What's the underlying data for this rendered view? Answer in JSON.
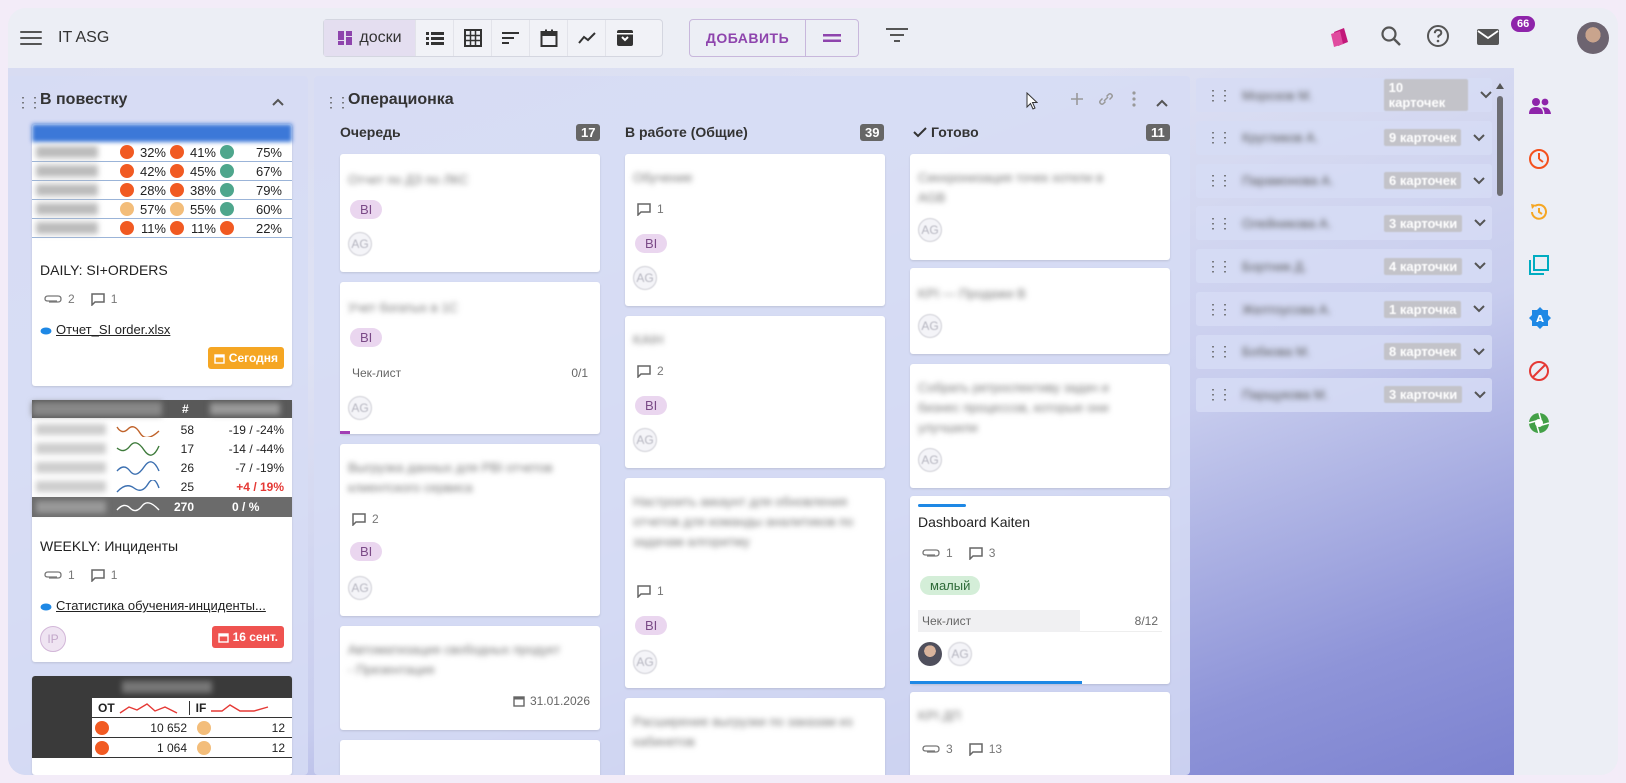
{
  "topbar": {
    "space_title": "IT ASG",
    "views": {
      "boards_label": "доски"
    },
    "add_label": "ДОБАВИТЬ",
    "notifications_count": "66"
  },
  "colors": {
    "accent": "#8e44ad",
    "badge": "#8e24aa",
    "today": "#f5a623",
    "overdue": "#ef5350"
  },
  "left_column": {
    "title": "В повестку",
    "card1": {
      "rows": [
        {
          "v1": "32%",
          "v2": "41%",
          "v3": "75%",
          "d1": "o",
          "d2": "o",
          "d3": "t"
        },
        {
          "v1": "42%",
          "v2": "45%",
          "v3": "67%",
          "d1": "o",
          "d2": "o",
          "d3": "t"
        },
        {
          "v1": "28%",
          "v2": "38%",
          "v3": "79%",
          "d1": "o",
          "d2": "o",
          "d3": "t"
        },
        {
          "v1": "57%",
          "v2": "55%",
          "v3": "60%",
          "d1": "y",
          "d2": "y",
          "d3": "t"
        },
        {
          "v1": "11%",
          "v2": "11%",
          "v3": "22%",
          "d1": "o",
          "d2": "o",
          "d3": "o"
        }
      ],
      "title": "DAILY: SI+ORDERS",
      "attachments": "2",
      "comments": "1",
      "file": "Отчет_SI order.xlsx",
      "due": "Сегодня"
    },
    "card2": {
      "header_hash": "#",
      "rows": [
        {
          "n": "58",
          "delta": "-19 / -24%",
          "red": false,
          "color": "#c0632b"
        },
        {
          "n": "17",
          "delta": "-14 / -44%",
          "red": false,
          "color": "#3d7a3a"
        },
        {
          "n": "26",
          "delta": "-7 / -19%",
          "red": false,
          "color": "#3b6fb0"
        },
        {
          "n": "25",
          "delta": "+4 / 19%",
          "red": true,
          "color": "#3b6fb0"
        }
      ],
      "total_n": "270",
      "total_delta": "0 / %",
      "title": "WEEKLY: Инциденты",
      "attachments": "1",
      "comments": "1",
      "file": "Статистика обучения-инциденты...",
      "assignee": "IP",
      "due": "16 сент."
    },
    "card3": {
      "col1": "OT",
      "col2": "IF",
      "rows": [
        {
          "v1": "10 652",
          "v2": "12"
        },
        {
          "v1": "1 064",
          "v2": "12"
        }
      ]
    }
  },
  "board": {
    "title": "Операционка",
    "queue": {
      "title": "Очередь",
      "count": "17",
      "cards": [
        {
          "text": "Отчет по ДЗ по ЛКС",
          "tag": "BI",
          "assignee": "AG"
        },
        {
          "text": "Учет богатых в 1С",
          "tag": "BI",
          "checklist_label": "Чек-лист",
          "checklist": "0/1",
          "assignee": "AG"
        },
        {
          "text": "Выгрузка данных для PBI отчетов клиентского сервиса",
          "comments": "2",
          "tag": "BI",
          "assignee": "AG"
        },
        {
          "text": "Автоматизация свободных продукт - Презентация",
          "date": "31.01.2026"
        }
      ]
    },
    "in_progress": {
      "title": "В работе (Общие)",
      "count": "39",
      "cards": [
        {
          "text": "Обучение",
          "comments": "1",
          "tag": "BI",
          "assignee": "AG"
        },
        {
          "text": "KAIH",
          "comments": "2",
          "tag": "BI",
          "assignee": "AG"
        },
        {
          "text": "Настроить аккаунт для обновления отчетов для команды аналитиков по задачам алгоритму",
          "comments": "1",
          "tag": "BI",
          "assignee": "AG"
        },
        {
          "text": "Расширение выгрузки по заказам из кабинетов"
        }
      ]
    },
    "done": {
      "title": "Готово",
      "count": "11",
      "cards": [
        {
          "text": "Синхронизация точек хотели в AGB",
          "assignee": "AG"
        },
        {
          "text": "KPI — Продажи В",
          "assignee": "AG"
        },
        {
          "text": "Собрать ретроспективу задач и бизнес процессов, которые они улучшили",
          "assignee": "AG"
        },
        {
          "text": "Dashboard Kaiten",
          "attachments": "1",
          "comments": "3",
          "tag": "малый",
          "checklist_label": "Чек-лист",
          "checklist": "8/12",
          "assignee": "AG"
        },
        {
          "text": "KPI ДП",
          "attachments": "3",
          "comments": "13"
        }
      ]
    }
  },
  "lanes": [
    {
      "name": "Морозов М.",
      "count": "10 карточек"
    },
    {
      "name": "Кругликов А.",
      "count": "9 карточек"
    },
    {
      "name": "Парамонова А.",
      "count": "6 карточек"
    },
    {
      "name": "Олейникова А.",
      "count": "3 карточки"
    },
    {
      "name": "Бортник Д.",
      "count": "4 карточки"
    },
    {
      "name": "Желтоусова А.",
      "count": "1 карточка"
    },
    {
      "name": "Бобкова М.",
      "count": "8 карточек"
    },
    {
      "name": "Парщукова М.",
      "count": "3 карточки"
    }
  ]
}
